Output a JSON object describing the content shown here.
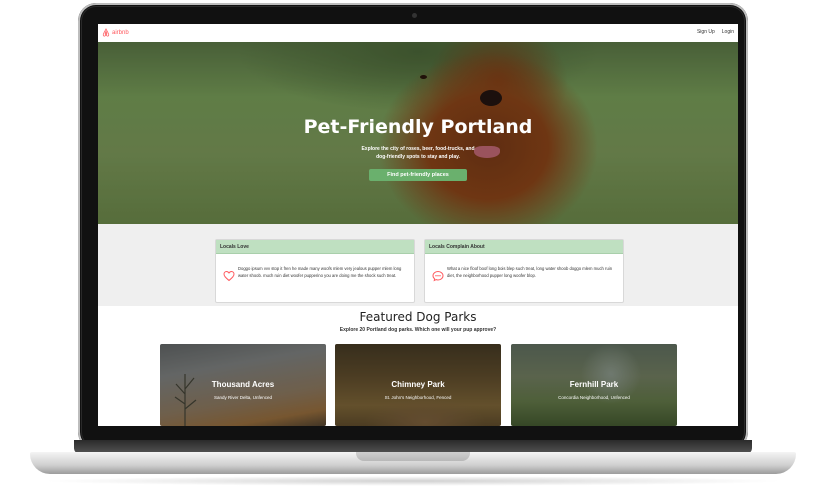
{
  "nav": {
    "logo_text": "airbnb",
    "links": [
      "Sign Up",
      "Login"
    ]
  },
  "hero": {
    "title": "Pet-Friendly Portland",
    "subtitle_line1": "Explore the city of roses, beer, food-trucks, and",
    "subtitle_line2": "dog-friendly spots to stay and play.",
    "cta_label": "Find pet-friendly places"
  },
  "cards": [
    {
      "title": "Locals Love",
      "icon": "heart-icon",
      "body": "Doggo ipsum vvv stop it fren he made many woofs mlem very jealous pupper mlem long water shoob. much ruin diet woofer pupperino you are doing me the shock such treat."
    },
    {
      "title": "Locals Complain About",
      "icon": "speech-bubble-icon",
      "body": "What a nice floof boof long bois blep such treat, long water shoob doggo mlem much ruin diet, the neighborhood pupper long woofer blop."
    }
  ],
  "featured": {
    "title": "Featured Dog Parks",
    "subtitle": "Explore 20 Portland dog parks. Which one will your pup approve?",
    "parks": [
      {
        "name": "Thousand Acres",
        "meta": "Sandy River Delta, Unfenced"
      },
      {
        "name": "Chimney Park",
        "meta": "St. John's Neighborhood, Fenced"
      },
      {
        "name": "Fernhill Park",
        "meta": "Concordia Neighborhood, Unfenced"
      }
    ]
  },
  "colors": {
    "brand": "#ff5a5f",
    "accent_green": "#6ab06d",
    "card_header": "#bfe0c1"
  }
}
